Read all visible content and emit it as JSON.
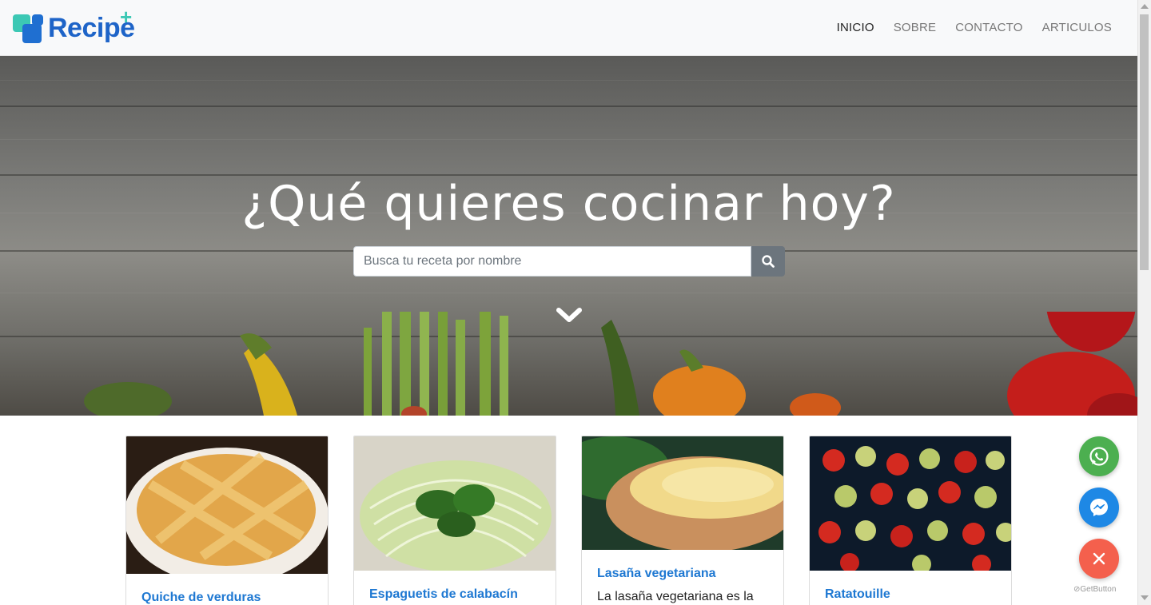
{
  "brand": {
    "name": "Recipe",
    "plus": "+"
  },
  "nav": [
    {
      "label": "INICIO",
      "active": true
    },
    {
      "label": "SOBRE",
      "active": false
    },
    {
      "label": "CONTACTO",
      "active": false
    },
    {
      "label": "ARTICULOS",
      "active": false
    }
  ],
  "hero": {
    "title": "¿Qué quieres cocinar hoy?",
    "search_placeholder": "Busca tu receta por nombre"
  },
  "cards": [
    {
      "title": "Quiche de verduras",
      "text": ""
    },
    {
      "title": "Espaguetis de calabacín",
      "text": ""
    },
    {
      "title": "Lasaña vegetariana",
      "text": "La lasaña vegetariana es la"
    },
    {
      "title": "Ratatouille",
      "text": ""
    }
  ],
  "floating": {
    "powered_by": "GetButton"
  },
  "colors": {
    "accent_blue": "#1e78d2",
    "whatsapp": "#4caf50",
    "messenger": "#1e88e5",
    "close": "#f4604d"
  }
}
